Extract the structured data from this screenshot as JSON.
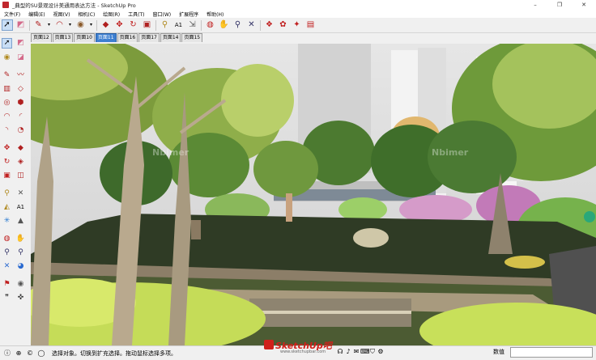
{
  "window": {
    "title": "_典型的SU景观设计美通用表达方法 - SketchUp Pro",
    "controls": [
      "–",
      "❐",
      "✕"
    ]
  },
  "menu": [
    "文件(F)",
    "编辑(E)",
    "视图(V)",
    "相机(C)",
    "绘图(R)",
    "工具(T)",
    "窗口(W)",
    "扩展程序",
    "帮助(H)"
  ],
  "toolbar": {
    "icons": [
      "select-icon",
      "eraser-icon",
      "pencil-icon",
      "chevron-down-icon",
      "arc-icon",
      "chevron-down-icon",
      "paint-bucket-icon",
      "chevron-down-icon",
      "pushpull-icon",
      "move-icon",
      "rotate-icon",
      "offset-icon",
      "tape-measure-icon",
      "text-icon",
      "dimension-icon",
      "orbit-icon",
      "pan-icon",
      "zoom-icon",
      "zoom-extents-icon",
      "warehouse-icon",
      "extension-icon",
      "layout-icon",
      "styles-icon"
    ]
  },
  "scene_tabs": [
    "页面12",
    "页面13",
    "页面10",
    "页面11",
    "页面16",
    "页面17",
    "页面14",
    "页面15"
  ],
  "active_tab": "页面11",
  "status": {
    "message": "选择对象。切换到扩充选择。拖动鼠标选择多项。",
    "measure_label": "数值",
    "measure_value": ""
  },
  "logo": {
    "text": "SketchUp吧",
    "sub": "www.sketchupbar.com"
  },
  "watermarks": [
    "Nbimer",
    "Nbimer"
  ],
  "colors": {
    "active_tab": "#3d7fd1",
    "logo_red": "#d0201b"
  }
}
